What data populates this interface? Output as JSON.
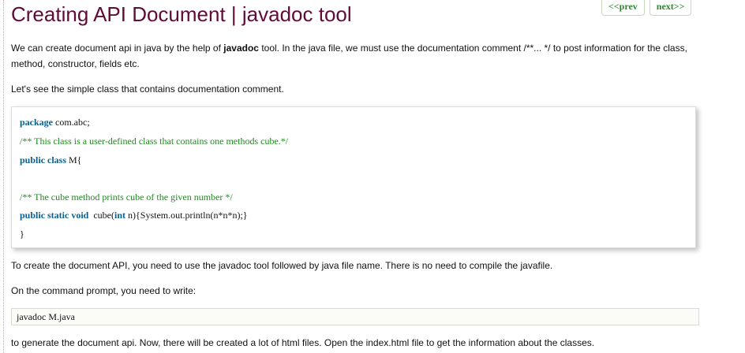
{
  "nav": {
    "prev_label": "<<prev",
    "next_label": "next>>"
  },
  "page": {
    "title": "Creating API Document | javadoc tool",
    "intro_before": "We can create document api in java by the help of ",
    "intro_bold": "javadoc",
    "intro_after": " tool. In the java file, we must use the documentation comment /**... */ to post information for the class, method, constructor, fields etc.",
    "lead": "Let's see the simple class that contains documentation comment.",
    "para_create": "To create the document API, you need to use the javadoc tool followed by java file name. There is no need to compile the javafile.",
    "para_cmd": "On the command prompt, you need to write:",
    "command": "javadoc M.java",
    "para_after": "to generate the document api. Now, there will be created a lot of html files. Open the index.html file to get the information about the classes."
  },
  "code": {
    "l1_kw": "package",
    "l1_rest": " com.abc;",
    "l2_comment": "/** This class is a user-defined class that contains one methods cube.*/",
    "l3_kw": "public class",
    "l3_rest": " M{",
    "l5_comment": "/** The cube method prints cube of the given number */",
    "l6_kw": "public static void",
    "l6_mid": "  cube(",
    "l6_kw2": "int",
    "l6_rest": " n){System.out.println(n*n*n);}",
    "l7": "}"
  },
  "colors": {
    "title": "#610b38",
    "keyword": "#0b5e8c",
    "comment": "#1d8a1d",
    "nav": "#2a8a2a"
  }
}
